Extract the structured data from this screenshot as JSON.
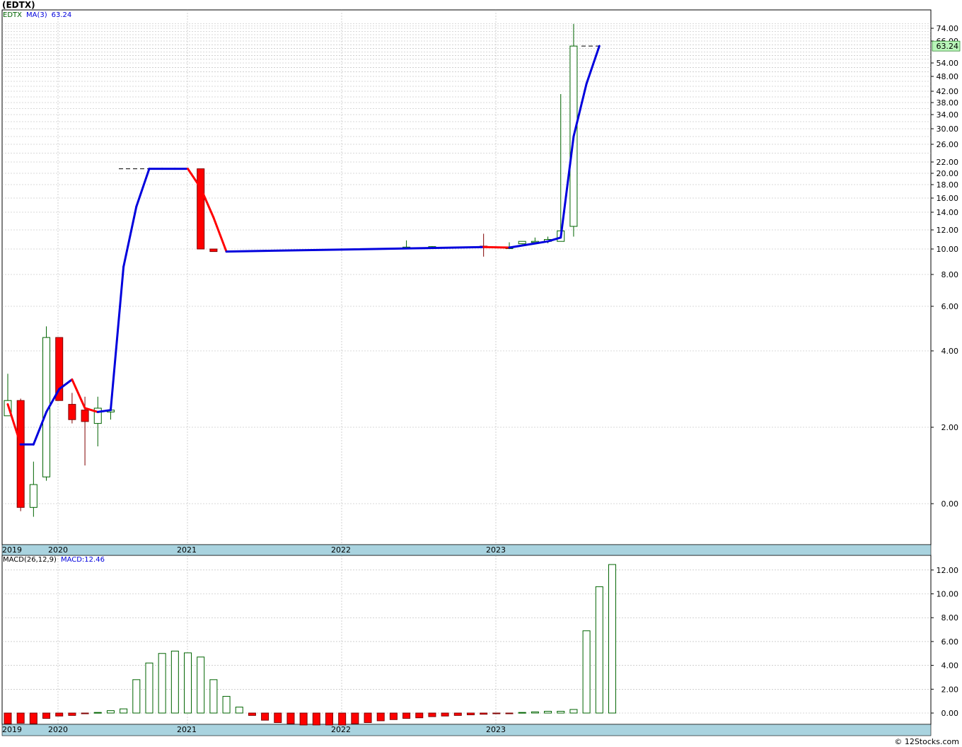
{
  "title": "(EDTX)",
  "watermark": "© 12Stocks.com",
  "legend_price": {
    "ticker": "EDTX",
    "ma_label": "MA(3)",
    "ma_value": "63.24"
  },
  "legend_macd": {
    "macd_label": "MACD(26,12,9)",
    "macd_value_label": "MACD:12.46"
  },
  "colors": {
    "up": "#006400",
    "down": "#ff0000",
    "ma_up": "#0000dd",
    "ma_down": "#ff0000",
    "axis_bar": "#a9d3df",
    "grid": "#b4b4b4",
    "last_price_bg": "#b9f5b9"
  },
  "chart_data": [
    {
      "type": "candlestick",
      "title": "(EDTX)",
      "scale": "log-like",
      "x_labels": [
        "2019",
        "2020",
        "2021",
        "2022",
        "2023"
      ],
      "y_ticks": [
        "0.00",
        "2.00",
        "4.00",
        "6.00",
        "8.00",
        "10.00",
        "12.00",
        "14.00",
        "16.00",
        "18.00",
        "20.00",
        "22.00",
        "26.00",
        "30.00",
        "34.00",
        "38.00",
        "42.00",
        "48.00",
        "54.00",
        "66.00",
        "74.00"
      ],
      "last_price_label": "63.24",
      "candles": [
        {
          "i": 0,
          "o": 2.3,
          "h": 3.4,
          "l": 2.3,
          "c": 2.7
        },
        {
          "i": 1,
          "o": 2.7,
          "h": 2.75,
          "l": -0.2,
          "c": -0.1
        },
        {
          "i": 2,
          "o": -0.1,
          "h": 1.1,
          "l": -0.35,
          "c": 0.5
        },
        {
          "i": 3,
          "o": 0.7,
          "h": 5.1,
          "l": 0.6,
          "c": 4.6
        },
        {
          "i": 4,
          "o": 4.6,
          "h": 4.6,
          "l": 2.7,
          "c": 2.7
        },
        {
          "i": 5,
          "o": 2.6,
          "h": 2.9,
          "l": 2.1,
          "c": 2.2
        },
        {
          "i": 6,
          "o": 2.45,
          "h": 2.8,
          "l": 1.0,
          "c": 2.15
        },
        {
          "i": 7,
          "o": 2.1,
          "h": 2.8,
          "l": 1.5,
          "c": 2.5
        },
        {
          "i": 8,
          "o": 2.4,
          "h": 2.45,
          "l": 2.2,
          "c": 2.45
        },
        {
          "i": 15,
          "o": 20.8,
          "h": 20.8,
          "l": 10.0,
          "c": 10.0
        },
        {
          "i": 16,
          "o": 10.0,
          "h": 10.0,
          "l": 9.8,
          "c": 9.8
        },
        {
          "i": 31,
          "o": 10.2,
          "h": 10.9,
          "l": 10.2,
          "c": 10.2
        },
        {
          "i": 33,
          "o": 10.2,
          "h": 10.3,
          "l": 10.2,
          "c": 10.25
        },
        {
          "i": 37,
          "o": 10.3,
          "h": 11.6,
          "l": 9.4,
          "c": 10.2
        },
        {
          "i": 39,
          "o": 10.1,
          "h": 10.7,
          "l": 10.1,
          "c": 10.15
        },
        {
          "i": 40,
          "o": 10.55,
          "h": 10.8,
          "l": 10.5,
          "c": 10.8
        },
        {
          "i": 41,
          "o": 10.7,
          "h": 11.2,
          "l": 10.7,
          "c": 10.8
        },
        {
          "i": 42,
          "o": 10.8,
          "h": 11.3,
          "l": 10.6,
          "c": 11.0
        },
        {
          "i": 43,
          "o": 10.8,
          "h": 41.0,
          "l": 10.8,
          "c": 11.9
        },
        {
          "i": 44,
          "o": 12.4,
          "h": 78.0,
          "l": 11.3,
          "c": 63.24
        }
      ],
      "ma": {
        "name": "MA(3)",
        "points": [
          [
            0,
            2.6
          ],
          [
            1,
            1.55
          ],
          [
            2,
            1.55
          ],
          [
            3,
            2.4
          ],
          [
            4,
            3.0
          ],
          [
            5,
            3.25
          ],
          [
            6,
            2.5
          ],
          [
            7,
            2.4
          ],
          [
            8,
            2.45
          ],
          [
            9,
            8.6
          ],
          [
            10,
            14.8
          ],
          [
            11,
            20.8
          ],
          [
            12,
            20.8
          ],
          [
            13,
            20.8
          ],
          [
            14,
            20.8
          ],
          [
            15,
            17.5
          ],
          [
            16,
            13.4
          ],
          [
            17,
            9.8
          ],
          [
            37,
            10.2
          ],
          [
            39,
            10.15
          ],
          [
            42,
            10.8
          ],
          [
            43,
            11.2
          ],
          [
            44,
            28.0
          ],
          [
            45,
            45.0
          ],
          [
            46,
            63.24
          ]
        ]
      }
    },
    {
      "type": "bar",
      "title": "MACD(26,12,9)",
      "x_labels": [
        "2019",
        "2020",
        "2021",
        "2022",
        "2023"
      ],
      "y_ticks": [
        "0.00",
        "2.00",
        "4.00",
        "6.00",
        "8.00",
        "10.00",
        "12.00"
      ],
      "values": [
        -0.9,
        -0.85,
        -0.9,
        -0.45,
        -0.25,
        -0.2,
        -0.05,
        0.05,
        0.2,
        0.35,
        2.8,
        4.2,
        5.0,
        5.2,
        5.05,
        4.7,
        2.8,
        1.4,
        0.5,
        -0.2,
        -0.6,
        -0.8,
        -0.9,
        -1.0,
        -1.0,
        -1.0,
        -1.0,
        -0.9,
        -0.8,
        -0.65,
        -0.55,
        -0.45,
        -0.4,
        -0.3,
        -0.25,
        -0.2,
        -0.15,
        -0.1,
        -0.05,
        -0.05,
        0.05,
        0.1,
        0.15,
        0.15,
        0.3,
        6.9,
        10.6,
        12.46
      ]
    }
  ]
}
